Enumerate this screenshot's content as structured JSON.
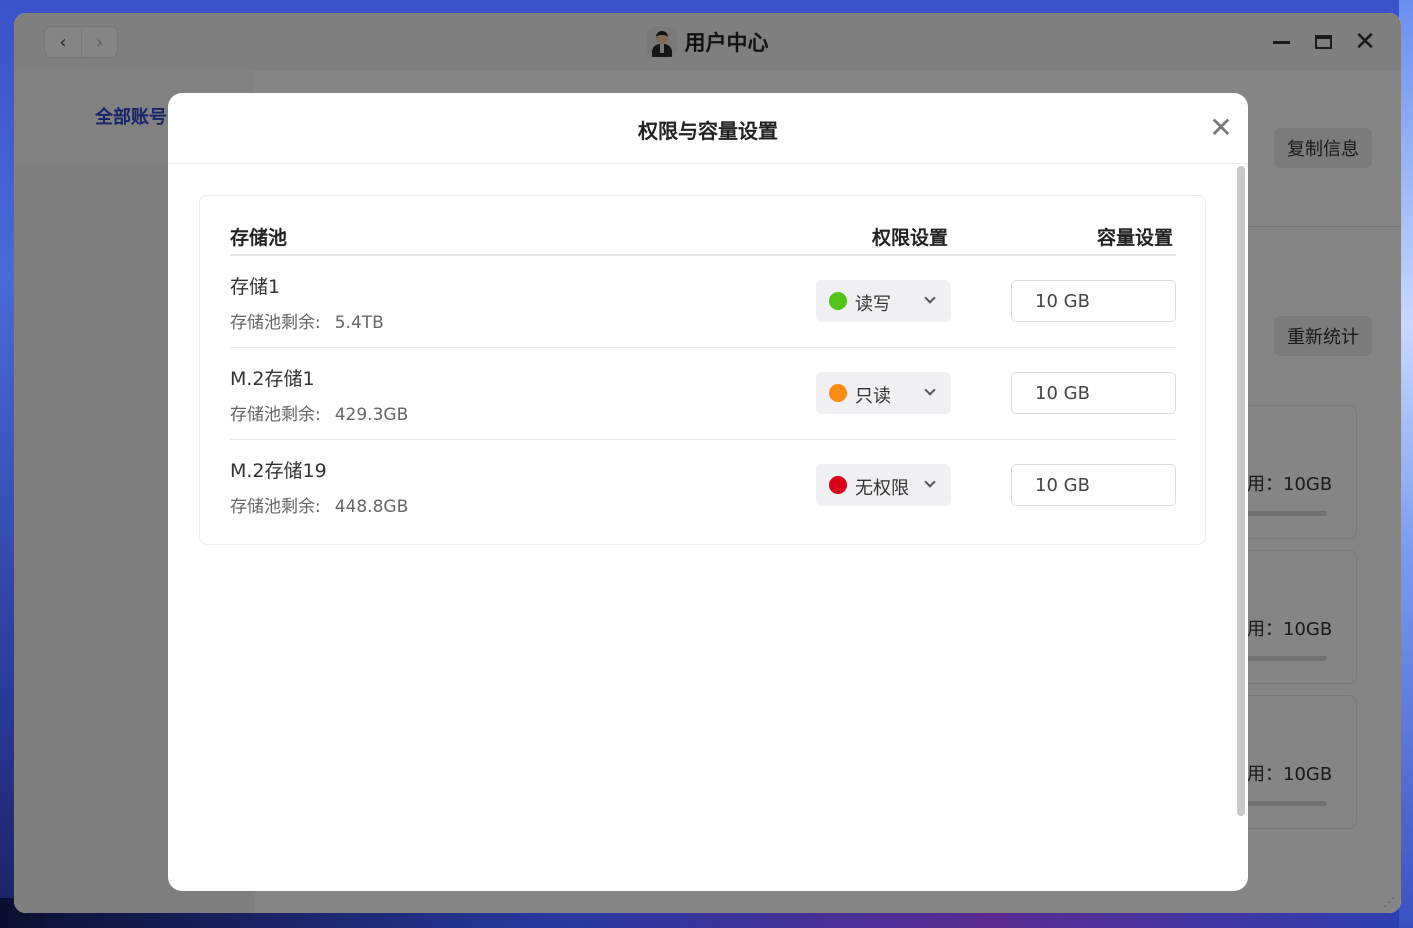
{
  "app": {
    "title": "用户中心",
    "nav_back": "‹",
    "nav_forward": "›",
    "close_glyph": "✕"
  },
  "background": {
    "sidebar_tab": "全部账号",
    "copy_button": "复制信息",
    "recalc_button": "重新统计",
    "cards": [
      {
        "text": "用：10GB"
      },
      {
        "text": "用：10GB"
      },
      {
        "text": "用：10GB"
      }
    ]
  },
  "modal": {
    "title": "权限与容量设置",
    "close_glyph": "✕",
    "columns": {
      "pool": "存储池",
      "permission": "权限设置",
      "capacity": "容量设置"
    },
    "remaining_label": "存储池剩余:",
    "rows": [
      {
        "name": "存储1",
        "remaining": "5.4TB",
        "permission": "读写",
        "permission_color": "#52c41a",
        "capacity": "10 GB"
      },
      {
        "name": "M.2存储1",
        "remaining": "429.3GB",
        "permission": "只读",
        "permission_color": "#fa8c16",
        "capacity": "10 GB"
      },
      {
        "name": "M.2存储19",
        "remaining": "448.8GB",
        "permission": "无权限",
        "permission_color": "#d9001b",
        "capacity": "10 GB"
      }
    ]
  }
}
